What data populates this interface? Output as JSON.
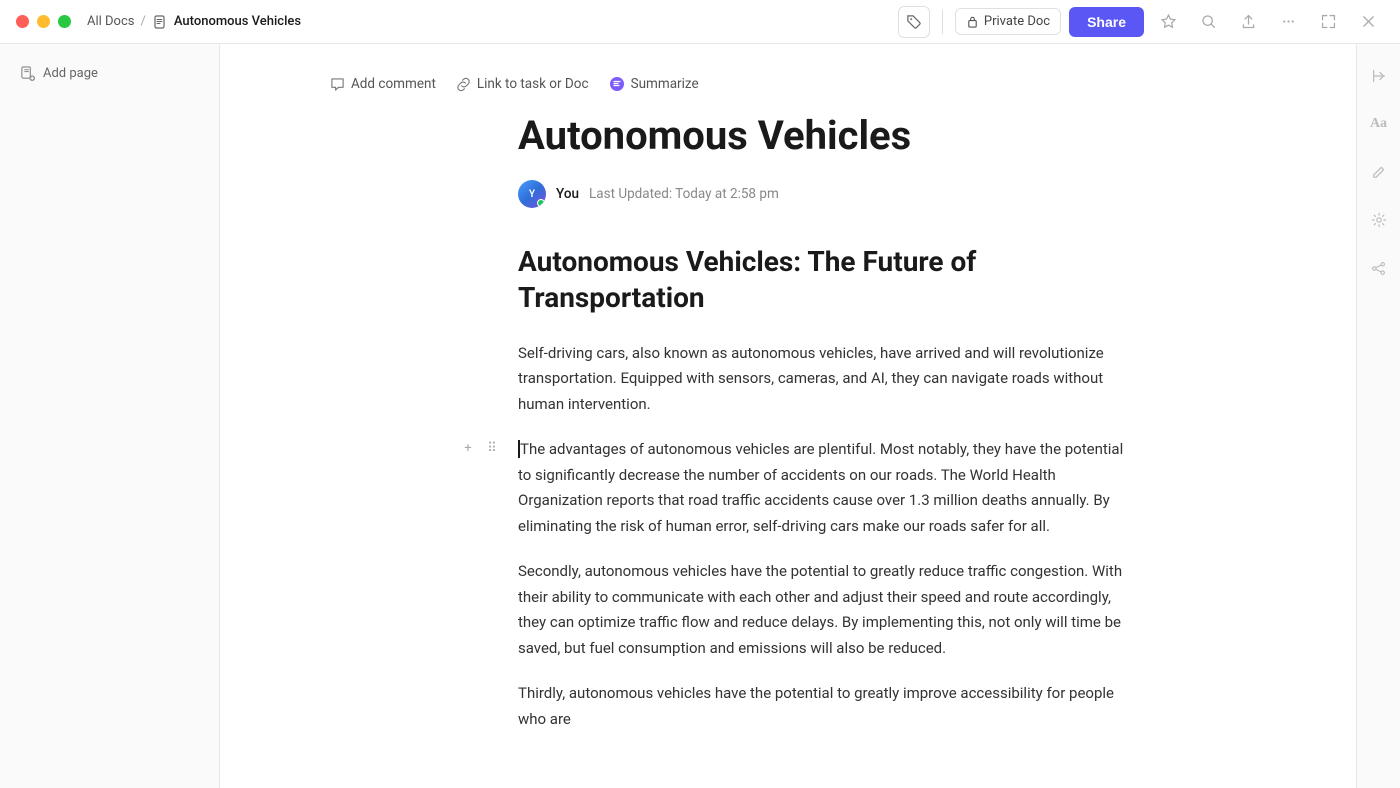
{
  "window": {
    "title": "Autonomous Vehicles"
  },
  "titlebar": {
    "breadcrumb_home": "All Docs",
    "breadcrumb_sep": "/",
    "doc_title": "Autonomous Vehicles",
    "private_label": "Private Doc",
    "share_label": "Share"
  },
  "sidebar": {
    "add_page_label": "Add page"
  },
  "toolbar": {
    "comment_label": "Add comment",
    "link_label": "Link to task or Doc",
    "summarize_label": "Summarize"
  },
  "doc": {
    "title": "Autonomous Vehicles",
    "author": "You",
    "updated": "Last Updated: Today at 2:58 pm",
    "heading": "Autonomous Vehicles: The Future of Transportation",
    "paragraph1": "Self-driving cars, also known as autonomous vehicles, have arrived and will revolutionize transportation. Equipped with sensors, cameras, and AI, they can navigate roads without human intervention.",
    "paragraph2_prefix": "",
    "paragraph2": "The advantages of autonomous vehicles are plentiful. Most notably, they have the potential to significantly decrease the number of accidents on our roads. The World Health Organization reports that road traffic accidents cause over 1.3 million deaths annually. By eliminating the risk of human error, self-driving cars make our roads safer for all.",
    "paragraph3": "Secondly, autonomous vehicles have the potential to greatly reduce traffic congestion. With their ability to communicate with each other and adjust their speed and route accordingly, they can optimize traffic flow and reduce delays. By implementing this, not only will time be saved, but fuel consumption and emissions will also be reduced.",
    "paragraph4_partial": "Thirdly, autonomous vehicles have the potential to greatly improve accessibility for people who are"
  }
}
